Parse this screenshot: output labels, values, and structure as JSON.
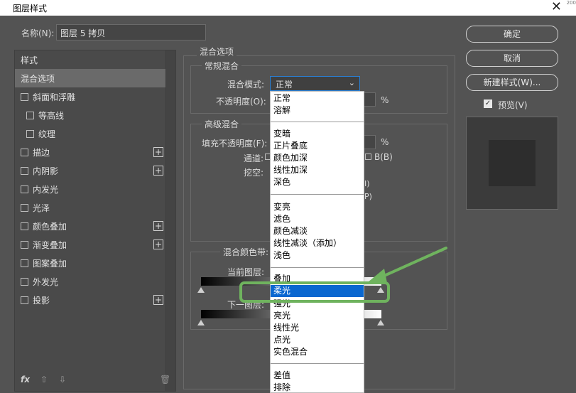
{
  "window": {
    "title": "图层样式",
    "corner_text": "200"
  },
  "name_field": {
    "label": "名称(N):",
    "value": "图层 5 拷贝"
  },
  "style_list": {
    "header": "样式",
    "items": [
      {
        "label": "混合选项",
        "checkbox": false,
        "plus": false,
        "selected": true
      },
      {
        "label": "斜面和浮雕",
        "checkbox": true,
        "plus": false
      },
      {
        "label": "等高线",
        "checkbox": true,
        "plus": false
      },
      {
        "label": "纹理",
        "checkbox": true,
        "plus": false
      },
      {
        "label": "描边",
        "checkbox": true,
        "plus": true
      },
      {
        "label": "内阴影",
        "checkbox": true,
        "plus": true
      },
      {
        "label": "内发光",
        "checkbox": true,
        "plus": false
      },
      {
        "label": "光泽",
        "checkbox": true,
        "plus": false
      },
      {
        "label": "颜色叠加",
        "checkbox": true,
        "plus": true
      },
      {
        "label": "渐变叠加",
        "checkbox": true,
        "plus": true
      },
      {
        "label": "图案叠加",
        "checkbox": true,
        "plus": false
      },
      {
        "label": "外发光",
        "checkbox": true,
        "plus": false
      },
      {
        "label": "投影",
        "checkbox": true,
        "plus": true
      }
    ],
    "footer": {
      "fx": "fx",
      "up": "⇧",
      "down": "⇩",
      "trash": "🗑"
    }
  },
  "blending": {
    "title": "混合选项",
    "general": {
      "title": "常规混合",
      "mode_label": "混合模式:",
      "mode_value": "正常",
      "opacity_label": "不透明度(O):",
      "opacity_unit": "%"
    },
    "advanced": {
      "title": "高级混合",
      "fill_label": "填充不透明度(F):",
      "fill_unit": "%",
      "channel_label": "通道:",
      "channel_b": "B(B)",
      "knockout_label": "挖空:",
      "frag_i": "I)",
      "frag_p": "P)"
    },
    "blend_if": {
      "title": "混合颜色带:",
      "current_layer": "当前图层:",
      "underlying_layer": "下一图层:"
    }
  },
  "buttons": {
    "ok": "确定",
    "cancel": "取消",
    "new_style": "新建样式(W)..."
  },
  "preview": {
    "label": "预览(V)",
    "checked": true
  },
  "dropdown": {
    "items": [
      "正常",
      "溶解",
      "变暗",
      "正片叠底",
      "颜色加深",
      "线性加深",
      "深色",
      "变亮",
      "滤色",
      "颜色减淡",
      "线性减淡（添加）",
      "浅色",
      "叠加",
      "柔光",
      "强光",
      "亮光",
      "线性光",
      "点光",
      "实色混合",
      "差值",
      "排除"
    ],
    "highlighted": "柔光"
  },
  "colors": {
    "highlight": "#0a67d0",
    "annotation": "#6fb35e",
    "focus_border": "#2a7fd4"
  }
}
